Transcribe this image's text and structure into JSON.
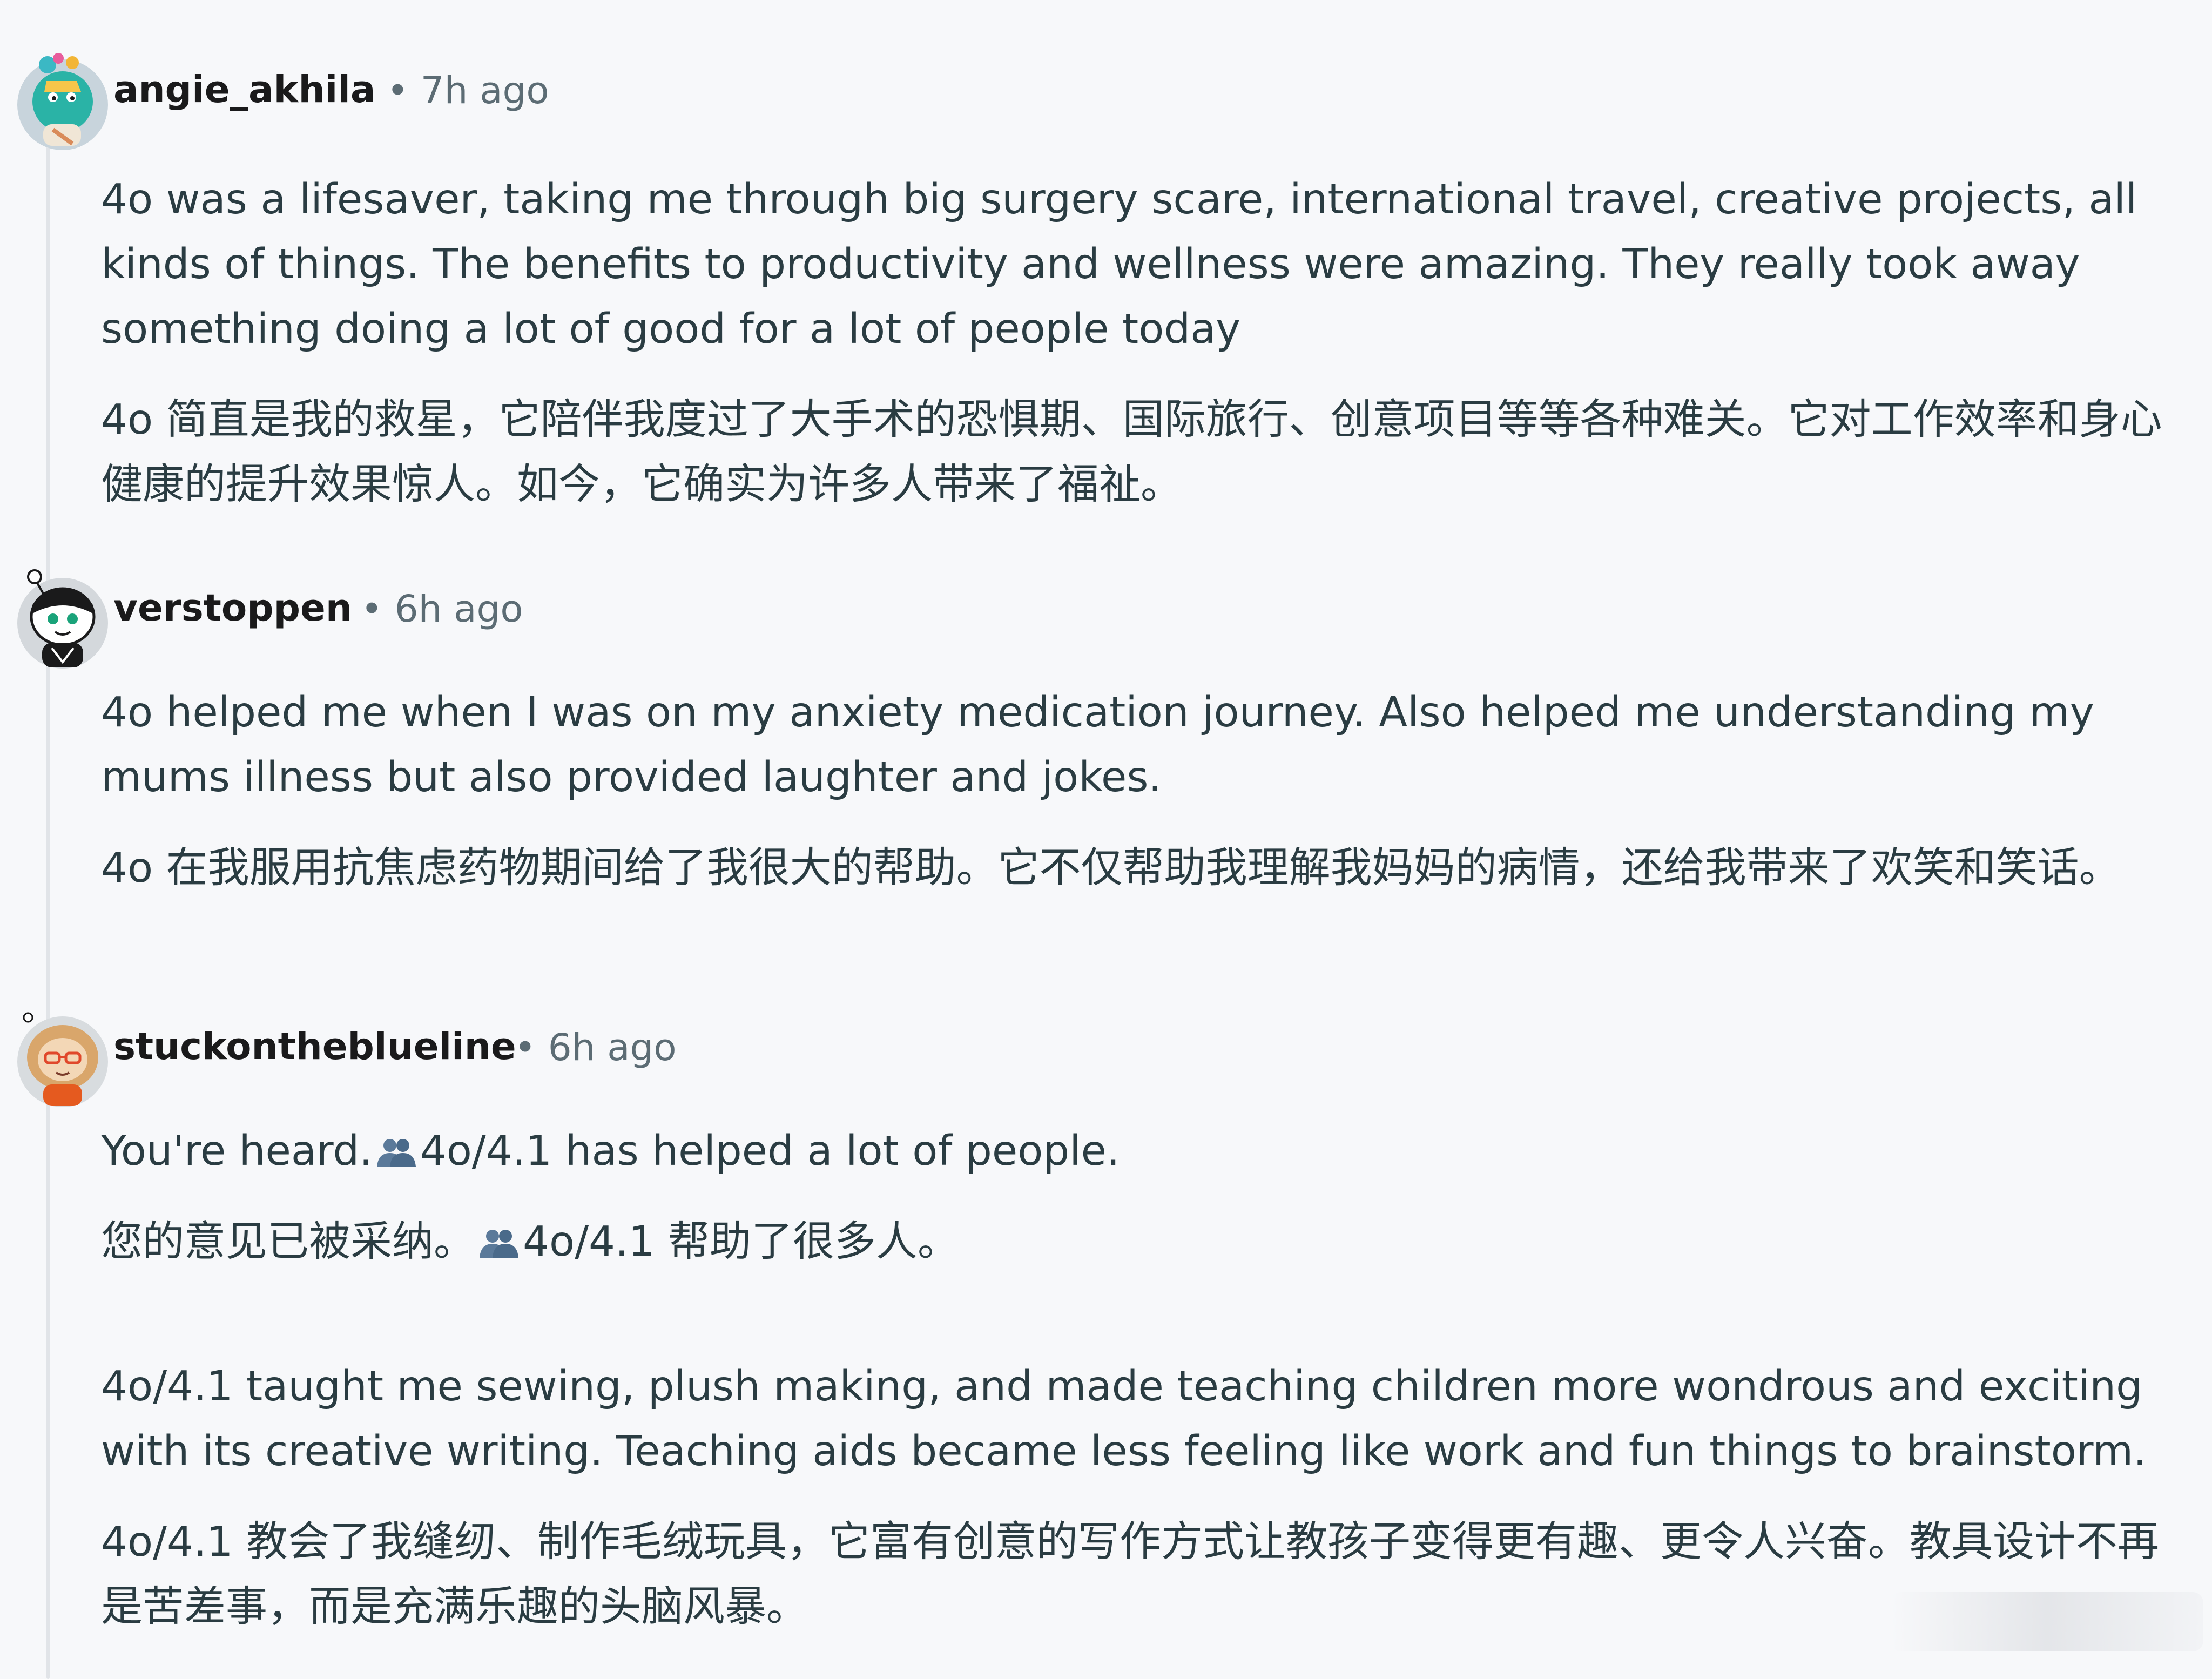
{
  "comments": [
    {
      "username": "angie_akhila",
      "dot": "•",
      "time": "7h ago",
      "avatar_icon": "avatar-snoo-teal",
      "paragraphs": [
        "4o was a lifesaver, taking me through big surgery scare, international travel, creative projects, all kinds of things. The benefits to productivity and wellness were amazing. They really took away something doing a lot of good for a lot of people today",
        "4o 简直是我的救星，它陪伴我度过了大手术的恐惧期、国际旅行、创意项目等等各种难关。它对工作效率和身心健康的提升效果惊人。如今，它确实为许多人带来了福祉。"
      ]
    },
    {
      "username": "verstoppen",
      "dot": "•",
      "time": "6h ago",
      "avatar_icon": "avatar-snoo-black",
      "paragraphs": [
        "4o helped me when I was on my anxiety medication journey. Also helped me understanding my mums illness but also provided laughter and jokes.",
        "4o 在我服用抗焦虑药物期间给了我很大的帮助。它不仅帮助我理解我妈妈的病情，还给我带来了欢笑和笑话。"
      ]
    },
    {
      "username": "stuckontheblueline",
      "dot": "•",
      "time": "6h ago",
      "avatar_icon": "avatar-snoo-orange",
      "line1_before": "You're heard.",
      "line1_after": "4o/4.1 has helped a lot of people.",
      "line2_before": "您的意见已被采纳。",
      "line2_after": "4o/4.1 帮助了很多人。",
      "emoji_icon": "people-silhouette-icon",
      "paragraphs": [
        "4o/4.1 taught me sewing, plush making, and made teaching children more wondrous and exciting with its creative writing. Teaching aids became less feeling like work and fun things to brainstorm.",
        "4o/4.1 教会了我缝纫、制作毛绒玩具，它富有创意的写作方式让教孩子变得更有趣、更令人兴奋。教具设计不再是苦差事，而是充满乐趣的头脑风暴。"
      ]
    }
  ],
  "colors": {
    "background": "#f7f8fa",
    "text": "#2a3c42",
    "username": "#1a1a1b",
    "meta": "#5c6c74",
    "thread_line": "#e1e4e8"
  }
}
